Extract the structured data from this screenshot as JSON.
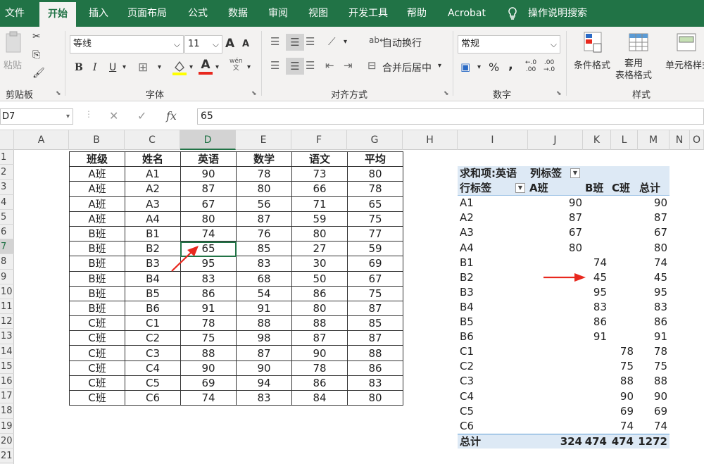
{
  "ribbon_tabs": [
    "文件",
    "开始",
    "插入",
    "页面布局",
    "公式",
    "数据",
    "审阅",
    "视图",
    "开发工具",
    "帮助",
    "Acrobat",
    "操作说明搜索"
  ],
  "clipboard": {
    "paste_label": "粘贴",
    "group_label": "剪贴板"
  },
  "font": {
    "name": "等线",
    "size": "11",
    "bold": "B",
    "italic": "I",
    "underline": "U",
    "group_label": "字体",
    "grow": "A",
    "shrink": "A",
    "font_color_glyph": "A",
    "phonetic": "wén\n文"
  },
  "alignment": {
    "wrap_label": "自动换行",
    "merge_label": "合并后居中",
    "group_label": "对齐方式"
  },
  "number": {
    "format": "常规",
    "percent": "%",
    "comma": ",",
    "inc_dec": "←.0\n.00",
    "dec_dec": ".00\n→.0",
    "group_label": "数字"
  },
  "styles": {
    "cond_format": "条件格式",
    "table_format": "套用\n表格格式",
    "cell_styles": "单元格样式",
    "group_label": "样式"
  },
  "formula_bar": {
    "name_box": "D7",
    "value": "65",
    "fx": "fx"
  },
  "columns": [
    "A",
    "B",
    "C",
    "D",
    "E",
    "F",
    "G",
    "H",
    "I",
    "J",
    "K",
    "L",
    "M",
    "N",
    "O"
  ],
  "selected_column": "D",
  "rows": [
    "1",
    "2",
    "3",
    "4",
    "5",
    "6",
    "7",
    "8",
    "9",
    "10",
    "11",
    "12",
    "13",
    "14",
    "15",
    "16",
    "17",
    "18",
    "19",
    "20",
    "21"
  ],
  "selected_row": "7",
  "table": {
    "headers": [
      "班级",
      "姓名",
      "英语",
      "数学",
      "语文",
      "平均"
    ],
    "rows": [
      [
        "A班",
        "A1",
        "90",
        "78",
        "73",
        "80"
      ],
      [
        "A班",
        "A2",
        "87",
        "80",
        "66",
        "78"
      ],
      [
        "A班",
        "A3",
        "67",
        "56",
        "71",
        "65"
      ],
      [
        "A班",
        "A4",
        "80",
        "87",
        "59",
        "75"
      ],
      [
        "B班",
        "B1",
        "74",
        "76",
        "80",
        "77"
      ],
      [
        "B班",
        "B2",
        "65",
        "85",
        "27",
        "59"
      ],
      [
        "B班",
        "B3",
        "95",
        "83",
        "30",
        "69"
      ],
      [
        "B班",
        "B4",
        "83",
        "68",
        "50",
        "67"
      ],
      [
        "B班",
        "B5",
        "86",
        "54",
        "86",
        "75"
      ],
      [
        "B班",
        "B6",
        "91",
        "91",
        "80",
        "87"
      ],
      [
        "C班",
        "C1",
        "78",
        "88",
        "88",
        "85"
      ],
      [
        "C班",
        "C2",
        "75",
        "98",
        "87",
        "87"
      ],
      [
        "C班",
        "C3",
        "88",
        "87",
        "90",
        "88"
      ],
      [
        "C班",
        "C4",
        "90",
        "90",
        "78",
        "86"
      ],
      [
        "C班",
        "C5",
        "69",
        "94",
        "86",
        "83"
      ],
      [
        "C班",
        "C6",
        "74",
        "83",
        "84",
        "80"
      ]
    ]
  },
  "pivot": {
    "title": "求和项:英语",
    "col_label": "列标签",
    "row_label": "行标签",
    "col_headers": [
      "A班",
      "B班",
      "C班",
      "总计"
    ],
    "rows": [
      [
        "A1",
        "90",
        "",
        "",
        "90"
      ],
      [
        "A2",
        "87",
        "",
        "",
        "87"
      ],
      [
        "A3",
        "67",
        "",
        "",
        "67"
      ],
      [
        "A4",
        "80",
        "",
        "",
        "80"
      ],
      [
        "B1",
        "",
        "74",
        "",
        "74"
      ],
      [
        "B2",
        "",
        "45",
        "",
        "45"
      ],
      [
        "B3",
        "",
        "95",
        "",
        "95"
      ],
      [
        "B4",
        "",
        "83",
        "",
        "83"
      ],
      [
        "B5",
        "",
        "86",
        "",
        "86"
      ],
      [
        "B6",
        "",
        "91",
        "",
        "91"
      ],
      [
        "C1",
        "",
        "",
        "78",
        "78"
      ],
      [
        "C2",
        "",
        "",
        "75",
        "75"
      ],
      [
        "C3",
        "",
        "",
        "88",
        "88"
      ],
      [
        "C4",
        "",
        "",
        "90",
        "90"
      ],
      [
        "C5",
        "",
        "",
        "69",
        "69"
      ],
      [
        "C6",
        "",
        "",
        "74",
        "74"
      ]
    ],
    "total": [
      "总计",
      "324",
      "474",
      "474",
      "1272"
    ]
  },
  "colors": {
    "accent": "#217346",
    "arrow": "#e8281e",
    "pivot_header": "#dde9f5"
  }
}
